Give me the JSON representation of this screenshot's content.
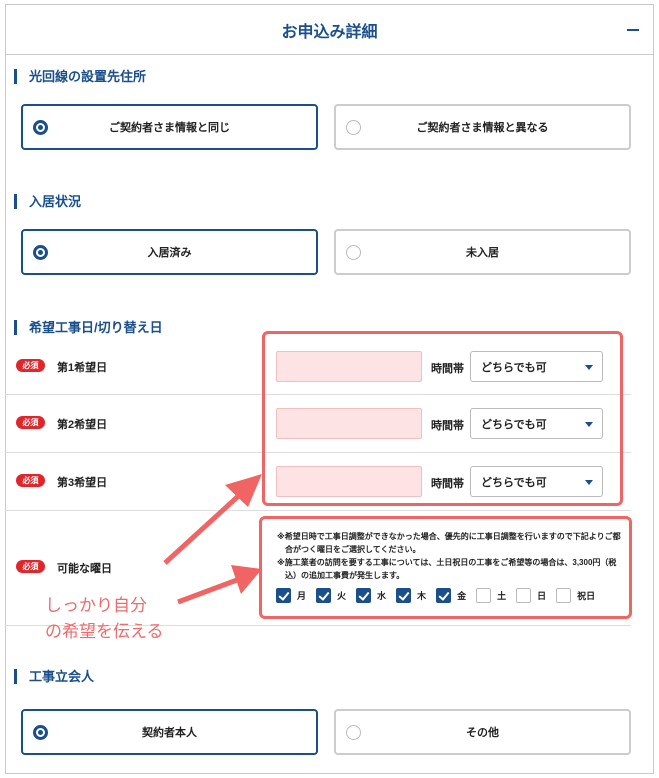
{
  "header": {
    "title": "お申込み詳細",
    "collapse_icon": "minus-icon"
  },
  "sections": {
    "address": {
      "title": "光回線の設置先住所",
      "options": [
        "ご契約者さま情報と同じ",
        "ご契約者さま情報と異なる"
      ],
      "selected": 0
    },
    "residence": {
      "title": "入居状況",
      "options": [
        "入居済み",
        "未入居"
      ],
      "selected": 0
    },
    "construction": {
      "title": "希望工事日/切り替え日",
      "required_badge": "必須",
      "rows": [
        {
          "label": "第1希望日",
          "date_value": "",
          "time_label": "時間帯",
          "time_value": "どちらでも可"
        },
        {
          "label": "第2希望日",
          "date_value": "",
          "time_label": "時間帯",
          "time_value": "どちらでも可"
        },
        {
          "label": "第3希望日",
          "date_value": "",
          "time_label": "時間帯",
          "time_value": "どちらでも可"
        }
      ],
      "weekdays": {
        "label": "可能な曜日",
        "note1": "※希望日時で工事日調整ができなかった場合、優先的に工事日調整を行いますので下記よりご都合がつく曜日をご選択してください。",
        "note2": "※施工業者の訪問を要する工事については、土日祝日の工事をご希望等の場合は、3,300円（税込）の追加工事費が発生します。",
        "days": [
          {
            "label": "月",
            "checked": true
          },
          {
            "label": "火",
            "checked": true
          },
          {
            "label": "水",
            "checked": true
          },
          {
            "label": "木",
            "checked": true
          },
          {
            "label": "金",
            "checked": true
          },
          {
            "label": "土",
            "checked": false
          },
          {
            "label": "日",
            "checked": false
          },
          {
            "label": "祝日",
            "checked": false
          }
        ]
      }
    },
    "witness": {
      "title": "工事立会人",
      "options": [
        "契約者本人",
        "その他"
      ],
      "selected": 0
    }
  },
  "annotation": {
    "line1": "しっかり自分",
    "line2": "の希望を伝える",
    "color": "#ef6b6b"
  },
  "colors": {
    "brand": "#1a4f8b",
    "required": "#e0262b",
    "highlight": "#f06464"
  }
}
